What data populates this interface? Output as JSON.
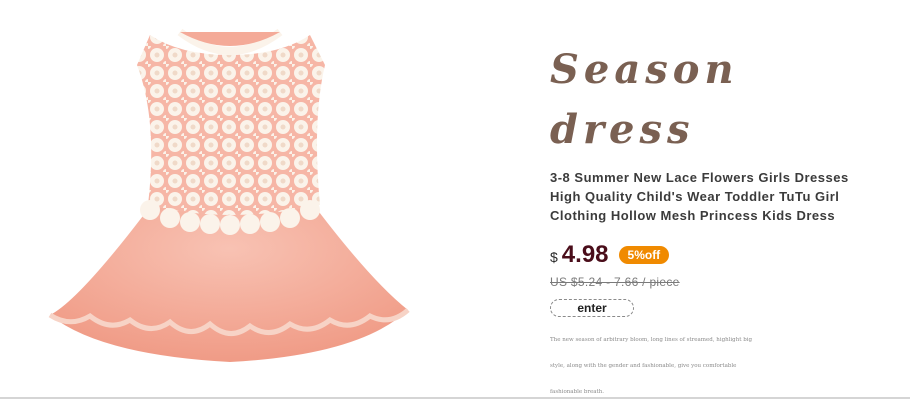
{
  "product": {
    "heading": "Season dress",
    "description": [
      "3-8 Summer New Lace Flowers Girls Dresses",
      "High Quality Child's Wear Toddler TuTu Girl",
      "Clothing Hollow Mesh Princess Kids Dress"
    ],
    "currency": "$",
    "price": "4.98",
    "discount": "5%off",
    "old_price": "US $5.24 - 7.66 / piece",
    "enter_label": "enter",
    "blurb": [
      "The new season of arbitrary bloom, long lines of streamed, highlight big",
      "style, along with the gender and fashionable, give you comfortable",
      "fashionable breath."
    ]
  },
  "colors": {
    "heading": "#7a6052",
    "price": "#4a0d1a",
    "badge": "#f08a00",
    "dress_pink": "#f3a592",
    "lace": "#fbf3ea"
  }
}
